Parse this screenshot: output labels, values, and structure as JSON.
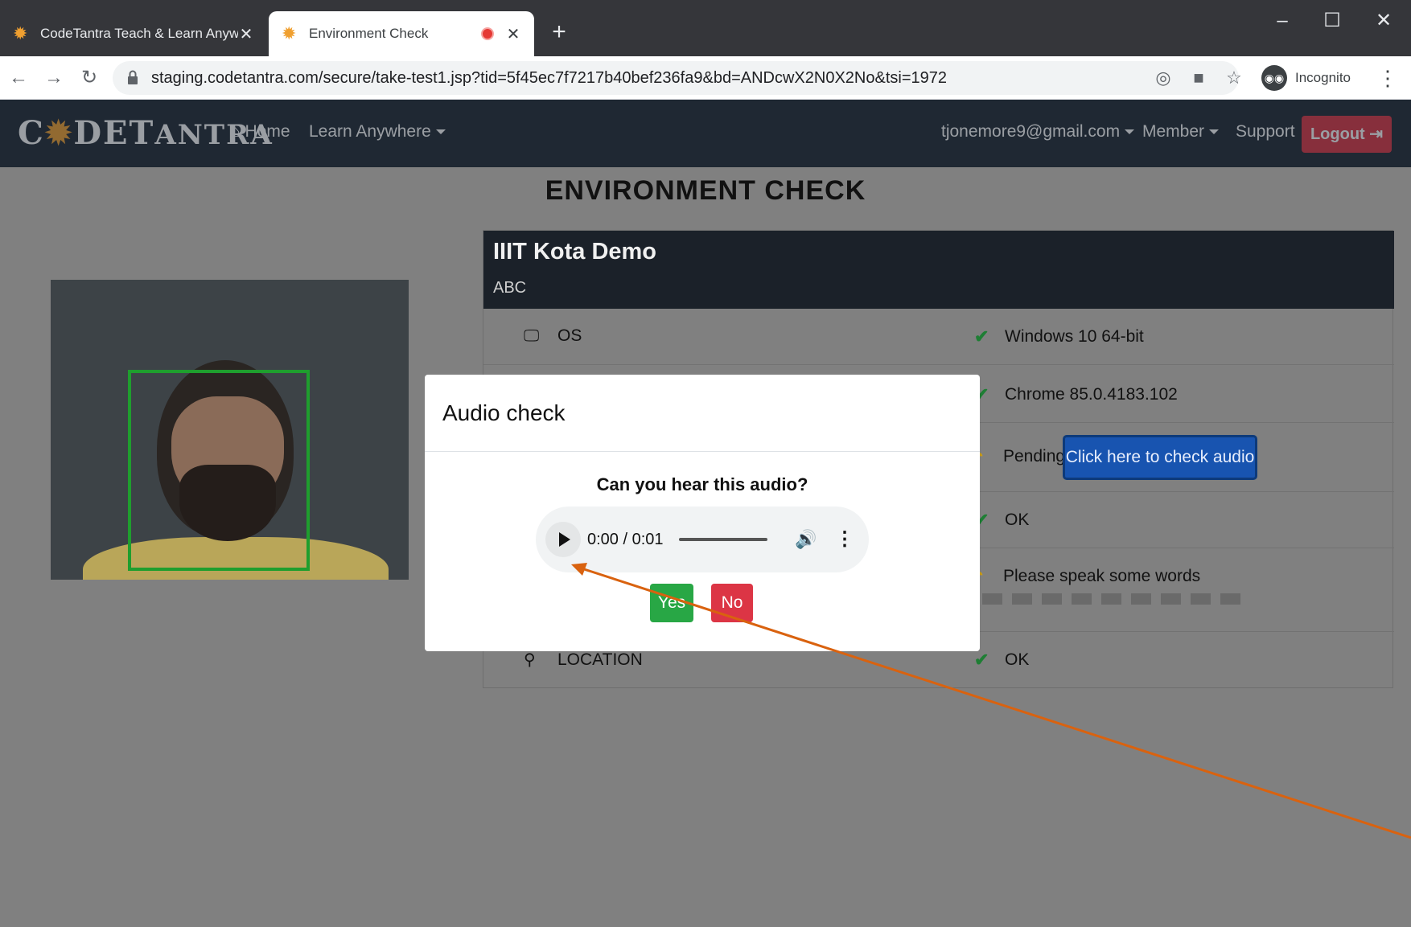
{
  "browser": {
    "tabs": [
      {
        "title": "CodeTantra Teach & Learn Anywh",
        "active": false
      },
      {
        "title": "Environment Check",
        "active": true
      }
    ],
    "url": "staging.codetantra.com/secure/take-test1.jsp?tid=5f45ec7f7217b40bef236fa9&bd=ANDcwX2N0X2No&tsi=1972",
    "incognito_label": "Incognito"
  },
  "site_nav": {
    "logo": "CODETANTRA",
    "home": "Home",
    "learn_anywhere": "Learn Anywhere",
    "email": "tjonemore9@gmail.com",
    "member": "Member",
    "support": "Support",
    "logout": "Logout"
  },
  "page": {
    "title": "ENVIRONMENT CHECK",
    "card": {
      "title": "IIIT Kota Demo",
      "subtitle": "ABC",
      "rows": [
        {
          "label": "OS",
          "status": "Windows 10 64-bit",
          "icon": "monitor-icon"
        },
        {
          "label": "",
          "status": "Chrome 85.0.4183.102",
          "icon": "browser-icon"
        },
        {
          "label": "",
          "status": "Pending",
          "icon": "speaker-icon"
        },
        {
          "label": "",
          "status": "OK",
          "icon": "camera-icon"
        },
        {
          "label": "",
          "status": "Please speak some words",
          "icon": "microphone-icon"
        },
        {
          "label": "LOCATION",
          "status": "OK",
          "icon": "map-marker-icon"
        }
      ],
      "audio_button": "Click here to check audio"
    }
  },
  "modal": {
    "title": "Audio check",
    "question": "Can you hear this audio?",
    "player_time": "0:00 / 0:01",
    "yes": "Yes",
    "no": "No"
  },
  "colors": {
    "annotation_arrow": "#d9620f",
    "accent_blue": "#1854b0",
    "danger": "#dc3545",
    "success": "#28a745"
  }
}
